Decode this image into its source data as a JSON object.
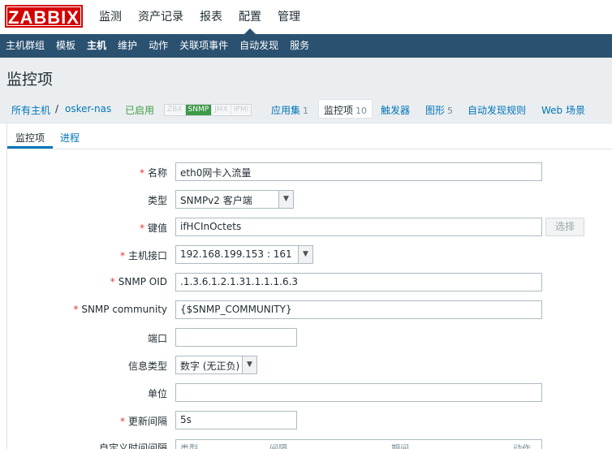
{
  "logo": "ZABBIX",
  "top_nav": [
    "监测",
    "资产记录",
    "报表",
    "配置",
    "管理"
  ],
  "sub_nav": [
    "主机群组",
    "模板",
    "主机",
    "维护",
    "动作",
    "关联项事件",
    "自动发现",
    "服务"
  ],
  "page_title": "监控项",
  "breadcrumb": {
    "all_hosts": "所有主机",
    "separator": "/",
    "host": "osker-nas",
    "status": "已启用",
    "badges": [
      "ZBX",
      "SNMP",
      "JMX",
      "IPMI"
    ],
    "applications": "应用集",
    "applications_count": "1",
    "items": "监控项",
    "items_count": "10",
    "triggers": "触发器",
    "graphs": "图形",
    "graphs_count": "5",
    "discovery": "自动发现规则",
    "web": "Web 场景"
  },
  "tabs": [
    "监控项",
    "进程"
  ],
  "form": {
    "name_label": "名称",
    "name_value": "eth0网卡入流量",
    "type_label": "类型",
    "type_value": "SNMPv2 客户端",
    "key_label": "键值",
    "key_value": "ifHCInOctets",
    "select_button": "选择",
    "interface_label": "主机接口",
    "interface_value": "192.168.199.153 : 161",
    "oid_label": "SNMP OID",
    "oid_value": ".1.3.6.1.2.1.31.1.1.1.6.3",
    "community_label": "SNMP community",
    "community_value": "{$SNMP_COMMUNITY}",
    "port_label": "端口",
    "port_value": "",
    "info_type_label": "信息类型",
    "info_type_value": "数字 (无正负)",
    "units_label": "单位",
    "units_value": "",
    "interval_label": "更新间隔",
    "interval_value": "5s",
    "custom_label": "自定义时间间隔",
    "custom_columns": [
      "类型",
      "间隔",
      "期间",
      "动作"
    ]
  }
}
